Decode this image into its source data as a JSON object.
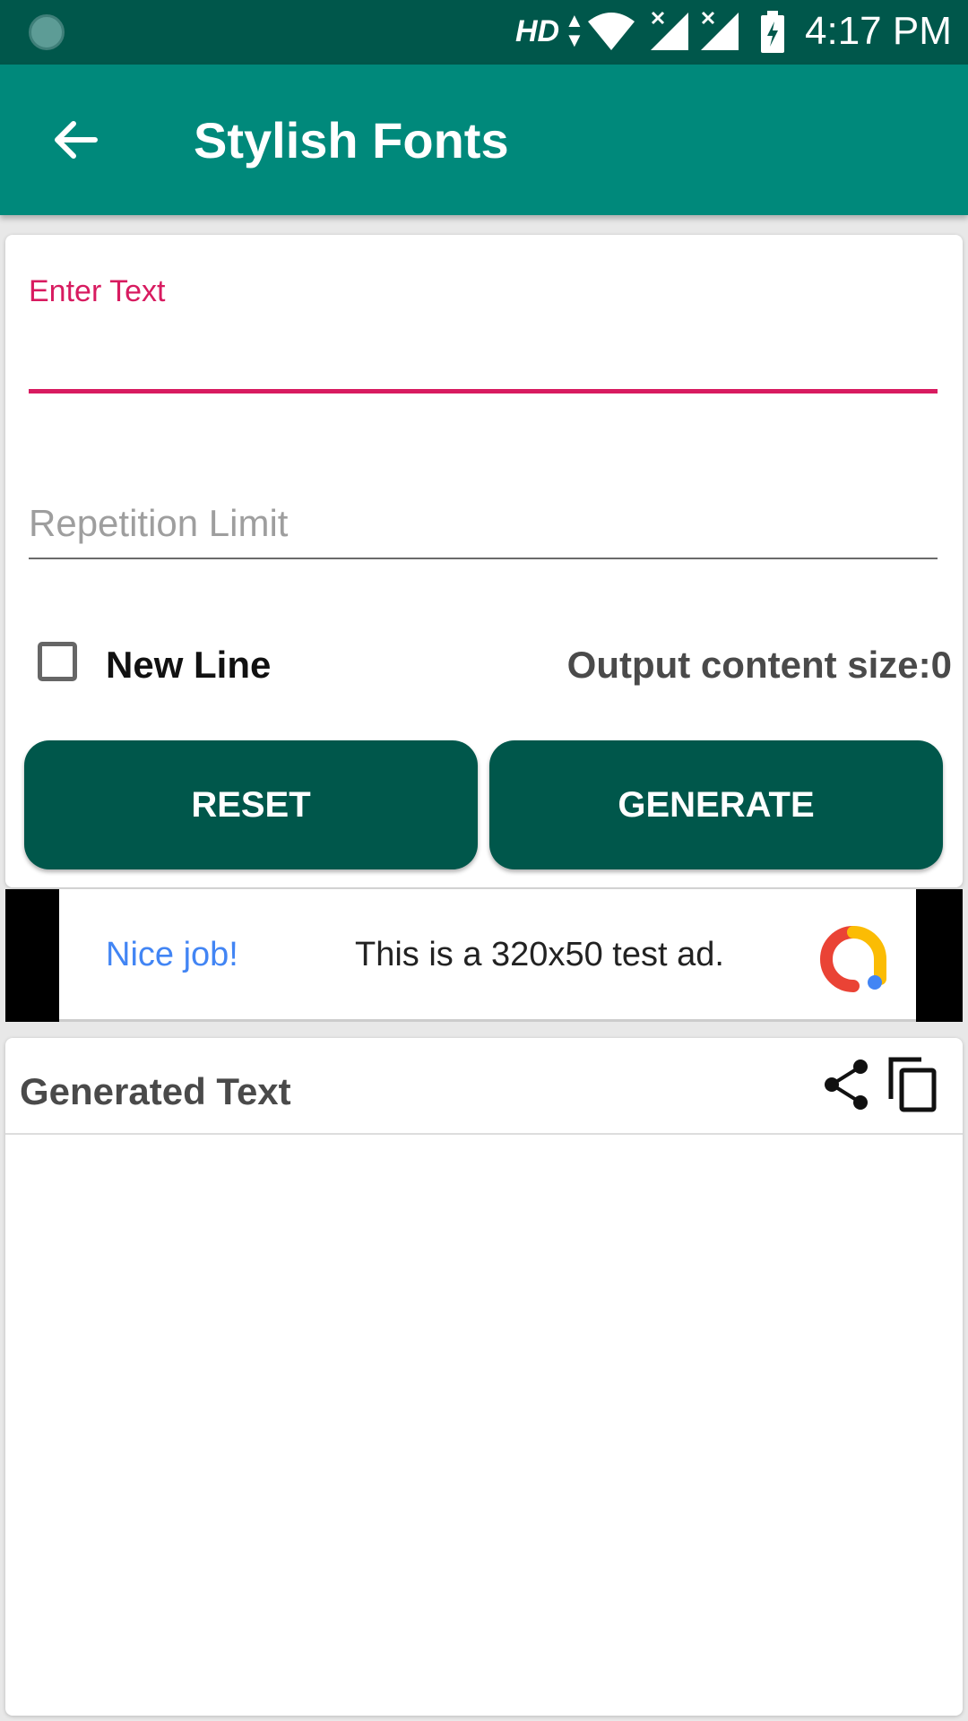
{
  "status_bar": {
    "network_label": "HD",
    "time": "4:17 PM"
  },
  "app_bar": {
    "title": "Stylish Fonts",
    "back_icon": "arrow-back-icon"
  },
  "form": {
    "enter_text_label": "Enter Text",
    "enter_text_value": "",
    "repetition_placeholder": "Repetition Limit",
    "repetition_value": "",
    "new_line_label": "New Line",
    "new_line_checked": false,
    "output_size_text": "Output content size:0",
    "reset_label": "RESET",
    "generate_label": "GENERATE"
  },
  "ad": {
    "headline": "Nice job!",
    "text": "This is a 320x50 test ad."
  },
  "generated": {
    "title": "Generated Text",
    "output": "",
    "share_icon": "share-icon",
    "copy_icon": "copy-icon"
  },
  "colors": {
    "status_bar": "#00574b",
    "app_bar": "#00897b",
    "accent": "#d81b60",
    "button": "#00574b"
  }
}
